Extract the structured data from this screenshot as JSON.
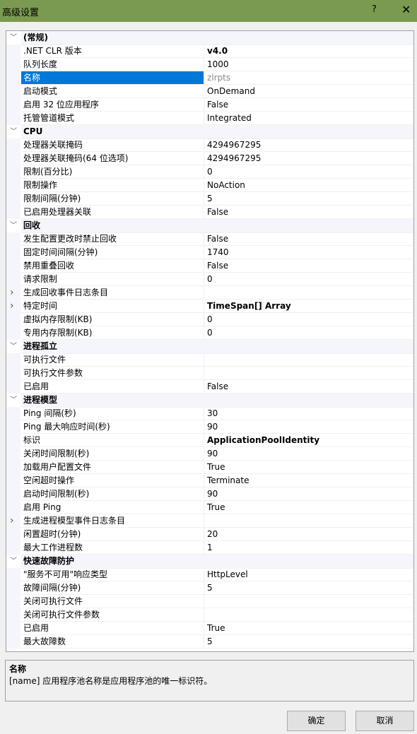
{
  "window": {
    "title": "高级设置",
    "help_label": "?",
    "close_label": "✕",
    "accent_color": "#7a9a50"
  },
  "groups": [
    {
      "label": "(常规)",
      "items": [
        {
          "name": ".NET CLR 版本",
          "value": "v4.0",
          "bold": true
        },
        {
          "name": "队列长度",
          "value": "1000"
        },
        {
          "name": "名称",
          "value": "zlrpts",
          "selected": true,
          "gray": true
        },
        {
          "name": "启动模式",
          "value": "OnDemand"
        },
        {
          "name": "启用 32 位应用程序",
          "value": "False"
        },
        {
          "name": "托管管道模式",
          "value": "Integrated"
        }
      ]
    },
    {
      "label": "CPU",
      "items": [
        {
          "name": "处理器关联掩码",
          "value": "4294967295"
        },
        {
          "name": "处理器关联掩码(64 位选项)",
          "value": "4294967295"
        },
        {
          "name": "限制(百分比)",
          "value": "0"
        },
        {
          "name": "限制操作",
          "value": "NoAction"
        },
        {
          "name": "限制间隔(分钟)",
          "value": "5"
        },
        {
          "name": "已启用处理器关联",
          "value": "False"
        }
      ]
    },
    {
      "label": "回收",
      "items": [
        {
          "name": "发生配置更改时禁止回收",
          "value": "False"
        },
        {
          "name": "固定时间间隔(分钟)",
          "value": "1740"
        },
        {
          "name": "禁用重叠回收",
          "value": "False"
        },
        {
          "name": "请求限制",
          "value": "0"
        },
        {
          "name": "生成回收事件日志条目",
          "value": "",
          "expandable": true
        },
        {
          "name": "特定时间",
          "value": "TimeSpan[] Array",
          "bold": true,
          "expandable": true
        },
        {
          "name": "虚拟内存限制(KB)",
          "value": "0"
        },
        {
          "name": "专用内存限制(KB)",
          "value": "0"
        }
      ]
    },
    {
      "label": "进程孤立",
      "items": [
        {
          "name": "可执行文件",
          "value": ""
        },
        {
          "name": "可执行文件参数",
          "value": ""
        },
        {
          "name": "已启用",
          "value": "False"
        }
      ]
    },
    {
      "label": "进程模型",
      "items": [
        {
          "name": "Ping 间隔(秒)",
          "value": "30"
        },
        {
          "name": "Ping 最大响应时间(秒)",
          "value": "90"
        },
        {
          "name": "标识",
          "value": "ApplicationPoolIdentity",
          "bold": true
        },
        {
          "name": "关闭时间限制(秒)",
          "value": "90"
        },
        {
          "name": "加载用户配置文件",
          "value": "True"
        },
        {
          "name": "空闲超时操作",
          "value": "Terminate"
        },
        {
          "name": "启动时间限制(秒)",
          "value": "90"
        },
        {
          "name": "启用 Ping",
          "value": "True"
        },
        {
          "name": "生成进程模型事件日志条目",
          "value": "",
          "expandable": true
        },
        {
          "name": "闲置超时(分钟)",
          "value": "20"
        },
        {
          "name": "最大工作进程数",
          "value": "1"
        }
      ]
    },
    {
      "label": "快速故障防护",
      "items": [
        {
          "name": "\"服务不可用\"响应类型",
          "value": "HttpLevel"
        },
        {
          "name": "故障间隔(分钟)",
          "value": "5"
        },
        {
          "name": "关闭可执行文件",
          "value": ""
        },
        {
          "name": "关闭可执行文件参数",
          "value": ""
        },
        {
          "name": "已启用",
          "value": "True"
        },
        {
          "name": "最大故障数",
          "value": "5"
        }
      ]
    }
  ],
  "description": {
    "title": "名称",
    "text": "[name] 应用程序池名称是应用程序池的唯一标识符。"
  },
  "buttons": {
    "ok": "确定",
    "cancel": "取消"
  }
}
